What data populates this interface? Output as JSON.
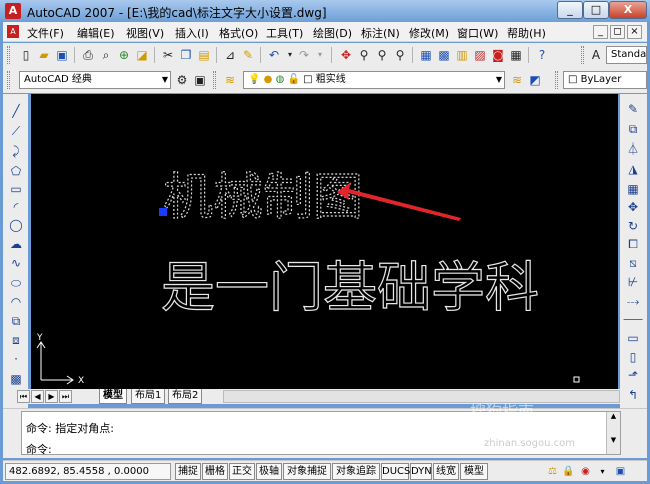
{
  "window": {
    "title": "AutoCAD 2007 - [E:\\我的cad\\标注文字大小设置.dwg]",
    "controls": {
      "minimize": "_",
      "maximize": "□",
      "close": "X"
    }
  },
  "menubar": {
    "items": [
      "文件(F)",
      "编辑(E)",
      "视图(V)",
      "插入(I)",
      "格式(O)",
      "工具(T)",
      "绘图(D)",
      "标注(N)",
      "修改(M)",
      "窗口(W)",
      "帮助(H)"
    ],
    "mdi_controls": {
      "minimize": "_",
      "restore": "◻",
      "close": "×"
    }
  },
  "toolbar": {
    "text_style_combo": "Standa",
    "workspace_combo": "AutoCAD 经典",
    "layer_combo": "粗实线",
    "color_combo": "ByLayer"
  },
  "drawing": {
    "text_line1": "机械制图",
    "text_line2": "是一门基础学科",
    "ucs_x": "X",
    "ucs_y": "Y",
    "arrow_color": "#e0262a",
    "grip_color": "#1a3cff"
  },
  "layout_tabs": {
    "tabs": [
      "模型",
      "布局1",
      "布局2"
    ],
    "active": "模型"
  },
  "command": {
    "history": "命令: 指定对角点:",
    "prompt": "命令:"
  },
  "statusbar": {
    "coordinates": "482.6892, 85.4558 , 0.0000",
    "toggles": [
      "捕捉",
      "栅格",
      "正交",
      "极轴",
      "对象捕捉",
      "对象追踪",
      "DUCS",
      "DYN",
      "线宽",
      "模型"
    ]
  },
  "watermark": {
    "text": "搜狗指南",
    "url": "zhinan.sogou.com"
  }
}
